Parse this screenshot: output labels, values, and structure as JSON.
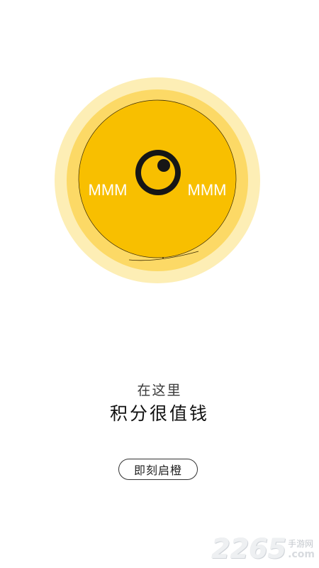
{
  "hero": {
    "zigzag_left_text": "MMM",
    "zigzag_right_text": "MMM",
    "colors": {
      "outer_ring": "#fdeeb5",
      "middle_ring": "#fcd966",
      "inner_disc": "#f8bf00",
      "eye": "#161616"
    }
  },
  "subtitle": "在这里",
  "title": "积分很值钱",
  "cta_button_label": "即刻启橙",
  "watermark": {
    "number": "2265",
    "chinese": "手游网",
    "domain": ".com"
  }
}
